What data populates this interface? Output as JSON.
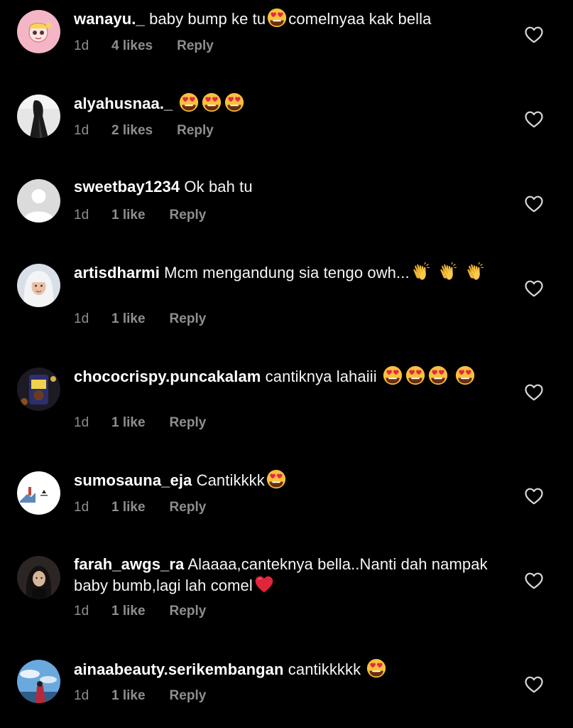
{
  "colors": {
    "background": "#000000",
    "text": "#f5f5f5",
    "meta": "#8e8e8e",
    "heart": "#d8d8d8"
  },
  "comments": [
    {
      "username": "wanayu._",
      "text_before": "baby bump ke tu",
      "emojis_mid": "heart-eyes",
      "text_after": "comelnyaa kak bella",
      "time": "1d",
      "likes": "4 likes",
      "reply": "Reply",
      "avatar": "cartoon-girl-avatar"
    },
    {
      "username": "alyahusnaa._",
      "text": "",
      "emojis": [
        "heart-eyes",
        "heart-eyes",
        "heart-eyes"
      ],
      "time": "1d",
      "likes": "2 likes",
      "reply": "Reply",
      "avatar": "dark-figure-avatar"
    },
    {
      "username": "sweetbay1234",
      "text": "Ok bah tu",
      "time": "1d",
      "likes": "1 like",
      "reply": "Reply",
      "avatar": "default-avatar"
    },
    {
      "username": "artisdharmi",
      "text": "Mcm mengandung sia tengo owh...",
      "emojis": [
        "clapping-hands",
        "clapping-hands",
        "clapping-hands"
      ],
      "time": "1d",
      "likes": "1 like",
      "reply": "Reply",
      "avatar": "hijab-woman-avatar"
    },
    {
      "username": "chococrispy.puncakalam",
      "text": "cantiknya lahaiii",
      "emojis": [
        "heart-eyes",
        "heart-eyes",
        "heart-eyes",
        "heart-eyes"
      ],
      "time": "1d",
      "likes": "1 like",
      "reply": "Reply",
      "avatar": "product-avatar"
    },
    {
      "username": "sumosauna_eja",
      "text": "Cantikkkk",
      "emojis": [
        "heart-eyes"
      ],
      "time": "1d",
      "likes": "1 like",
      "reply": "Reply",
      "avatar": "logo-avatar"
    },
    {
      "username": "farah_awgs_ra",
      "text": "Alaaaa,canteknya bella..Nanti dah nampak baby bumb,lagi lah comel",
      "emojis": [
        "red-heart"
      ],
      "time": "1d",
      "likes": "1 like",
      "reply": "Reply",
      "avatar": "woman-portrait-avatar"
    },
    {
      "username": "ainaabeauty.serikembangan",
      "text": "cantikkkkk",
      "emojis": [
        "heart-eyes"
      ],
      "time": "1d",
      "likes": "1 like",
      "reply": "Reply",
      "avatar": "sky-photo-avatar"
    }
  ]
}
